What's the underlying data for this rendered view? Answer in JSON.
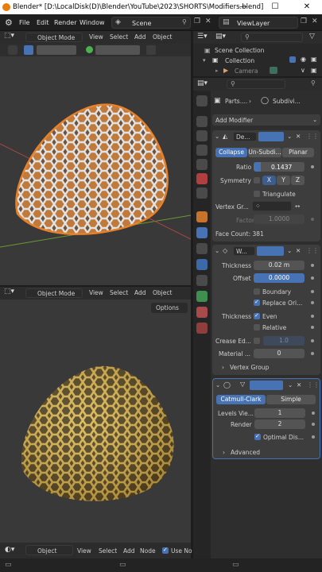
{
  "window": {
    "title": "Blender* [D:\\LocalDisk(D)\\Blender\\YouTube\\2023\\SHORTS\\Modifiers.blend]",
    "minimize": "—",
    "maximize": "☐",
    "close": "✕"
  },
  "menubar": {
    "file": "File",
    "edit": "Edit",
    "render": "Render",
    "window": "Window",
    "scene": "Scene",
    "view_layer": "ViewLayer"
  },
  "viewport_top": {
    "mode": "Object Mode",
    "view": "View",
    "select": "Select",
    "add": "Add",
    "object": "Object"
  },
  "viewport_bottom": {
    "mode": "Object Mode",
    "view": "View",
    "select": "Select",
    "add": "Add",
    "object": "Object",
    "options": "Options"
  },
  "outliner": {
    "scene_collection": "Scene Collection",
    "collection": "Collection",
    "camera": "Camera"
  },
  "properties": {
    "breadcrumb_object": "Parts....",
    "breadcrumb_modifier": "Subdivi...",
    "add_modifier": "Add Modifier",
    "decimate": {
      "name": "De...",
      "tab_collapse": "Collapse",
      "tab_unsubdiv": "Un-Subdi...",
      "tab_planar": "Planar",
      "ratio_label": "Ratio",
      "ratio": "0.1437",
      "ratio_fill": 0.14,
      "symmetry_label": "Symmetry",
      "axis_x": "X",
      "axis_y": "Y",
      "axis_z": "Z",
      "triangulate": "Triangulate",
      "vertex_group_label": "Vertex Gr...",
      "factor_label": "Factor",
      "factor": "1.0000",
      "face_count": "Face Count: 381"
    },
    "wireframe": {
      "name": "W...",
      "thickness_label": "Thickness",
      "thickness": "0.02 m",
      "offset_label": "Offset",
      "offset": "0.0000",
      "boundary": "Boundary",
      "replace_original": "Replace Ori...",
      "thickness2_label": "Thickness",
      "even": "Even",
      "relative": "Relative",
      "crease_label": "Crease Ed...",
      "crease": "1.0",
      "material_label": "Material ...",
      "material": "0",
      "vertex_group": "Vertex Group"
    },
    "subdivision": {
      "tab_catmull": "Catmull-Clark",
      "tab_simple": "Simple",
      "levels_label": "Levels Vie...",
      "levels": "1",
      "render_label": "Render",
      "render": "2",
      "optimal_display": "Optimal Dis...",
      "advanced": "Advanced"
    }
  },
  "node_editor": {
    "mode": "Object",
    "view": "View",
    "select": "Select",
    "add": "Add",
    "node": "Node",
    "use_nodes": "Use No"
  },
  "colors": {
    "accent": "#4772b3",
    "selection_orange": "#e8822a",
    "gold": "#c9a341"
  }
}
